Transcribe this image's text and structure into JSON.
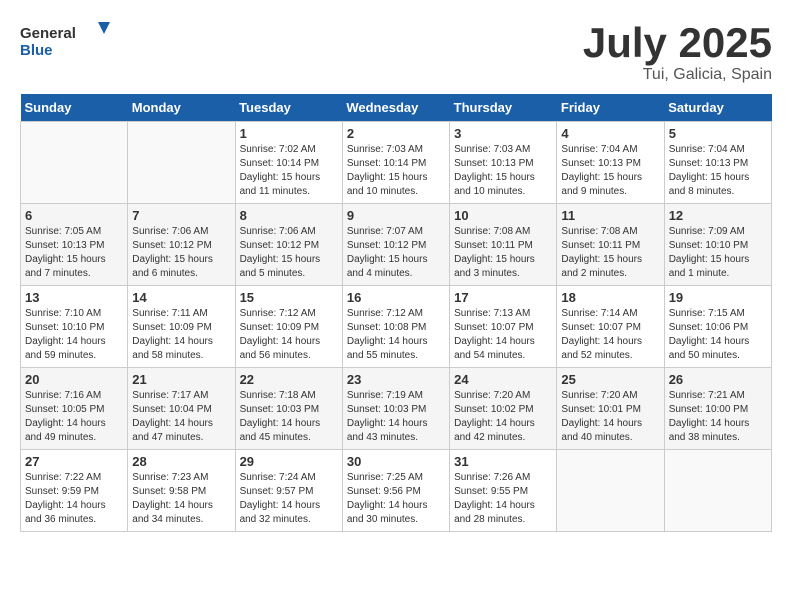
{
  "header": {
    "logo": {
      "general": "General",
      "blue": "Blue"
    },
    "title": "July 2025",
    "subtitle": "Tui, Galicia, Spain"
  },
  "weekdays": [
    "Sunday",
    "Monday",
    "Tuesday",
    "Wednesday",
    "Thursday",
    "Friday",
    "Saturday"
  ],
  "weeks": [
    [
      null,
      null,
      {
        "day": 1,
        "sunrise": "7:02 AM",
        "sunset": "10:14 PM",
        "daylight": "15 hours and 11 minutes."
      },
      {
        "day": 2,
        "sunrise": "7:03 AM",
        "sunset": "10:14 PM",
        "daylight": "15 hours and 10 minutes."
      },
      {
        "day": 3,
        "sunrise": "7:03 AM",
        "sunset": "10:13 PM",
        "daylight": "15 hours and 10 minutes."
      },
      {
        "day": 4,
        "sunrise": "7:04 AM",
        "sunset": "10:13 PM",
        "daylight": "15 hours and 9 minutes."
      },
      {
        "day": 5,
        "sunrise": "7:04 AM",
        "sunset": "10:13 PM",
        "daylight": "15 hours and 8 minutes."
      }
    ],
    [
      {
        "day": 6,
        "sunrise": "7:05 AM",
        "sunset": "10:13 PM",
        "daylight": "15 hours and 7 minutes."
      },
      {
        "day": 7,
        "sunrise": "7:06 AM",
        "sunset": "10:12 PM",
        "daylight": "15 hours and 6 minutes."
      },
      {
        "day": 8,
        "sunrise": "7:06 AM",
        "sunset": "10:12 PM",
        "daylight": "15 hours and 5 minutes."
      },
      {
        "day": 9,
        "sunrise": "7:07 AM",
        "sunset": "10:12 PM",
        "daylight": "15 hours and 4 minutes."
      },
      {
        "day": 10,
        "sunrise": "7:08 AM",
        "sunset": "10:11 PM",
        "daylight": "15 hours and 3 minutes."
      },
      {
        "day": 11,
        "sunrise": "7:08 AM",
        "sunset": "10:11 PM",
        "daylight": "15 hours and 2 minutes."
      },
      {
        "day": 12,
        "sunrise": "7:09 AM",
        "sunset": "10:10 PM",
        "daylight": "15 hours and 1 minute."
      }
    ],
    [
      {
        "day": 13,
        "sunrise": "7:10 AM",
        "sunset": "10:10 PM",
        "daylight": "14 hours and 59 minutes."
      },
      {
        "day": 14,
        "sunrise": "7:11 AM",
        "sunset": "10:09 PM",
        "daylight": "14 hours and 58 minutes."
      },
      {
        "day": 15,
        "sunrise": "7:12 AM",
        "sunset": "10:09 PM",
        "daylight": "14 hours and 56 minutes."
      },
      {
        "day": 16,
        "sunrise": "7:12 AM",
        "sunset": "10:08 PM",
        "daylight": "14 hours and 55 minutes."
      },
      {
        "day": 17,
        "sunrise": "7:13 AM",
        "sunset": "10:07 PM",
        "daylight": "14 hours and 54 minutes."
      },
      {
        "day": 18,
        "sunrise": "7:14 AM",
        "sunset": "10:07 PM",
        "daylight": "14 hours and 52 minutes."
      },
      {
        "day": 19,
        "sunrise": "7:15 AM",
        "sunset": "10:06 PM",
        "daylight": "14 hours and 50 minutes."
      }
    ],
    [
      {
        "day": 20,
        "sunrise": "7:16 AM",
        "sunset": "10:05 PM",
        "daylight": "14 hours and 49 minutes."
      },
      {
        "day": 21,
        "sunrise": "7:17 AM",
        "sunset": "10:04 PM",
        "daylight": "14 hours and 47 minutes."
      },
      {
        "day": 22,
        "sunrise": "7:18 AM",
        "sunset": "10:03 PM",
        "daylight": "14 hours and 45 minutes."
      },
      {
        "day": 23,
        "sunrise": "7:19 AM",
        "sunset": "10:03 PM",
        "daylight": "14 hours and 43 minutes."
      },
      {
        "day": 24,
        "sunrise": "7:20 AM",
        "sunset": "10:02 PM",
        "daylight": "14 hours and 42 minutes."
      },
      {
        "day": 25,
        "sunrise": "7:20 AM",
        "sunset": "10:01 PM",
        "daylight": "14 hours and 40 minutes."
      },
      {
        "day": 26,
        "sunrise": "7:21 AM",
        "sunset": "10:00 PM",
        "daylight": "14 hours and 38 minutes."
      }
    ],
    [
      {
        "day": 27,
        "sunrise": "7:22 AM",
        "sunset": "9:59 PM",
        "daylight": "14 hours and 36 minutes."
      },
      {
        "day": 28,
        "sunrise": "7:23 AM",
        "sunset": "9:58 PM",
        "daylight": "14 hours and 34 minutes."
      },
      {
        "day": 29,
        "sunrise": "7:24 AM",
        "sunset": "9:57 PM",
        "daylight": "14 hours and 32 minutes."
      },
      {
        "day": 30,
        "sunrise": "7:25 AM",
        "sunset": "9:56 PM",
        "daylight": "14 hours and 30 minutes."
      },
      {
        "day": 31,
        "sunrise": "7:26 AM",
        "sunset": "9:55 PM",
        "daylight": "14 hours and 28 minutes."
      },
      null,
      null
    ]
  ]
}
